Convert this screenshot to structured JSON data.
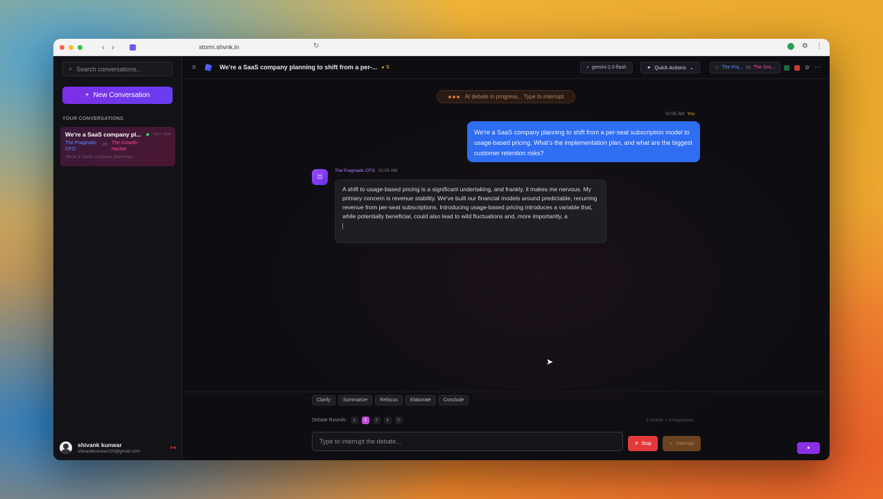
{
  "browser": {
    "url": "storm.shvnk.in"
  },
  "sidebar": {
    "search_placeholder": "Search conversations...",
    "new_conversation_label": "New Conversation",
    "section_label": "YOUR CONVERSATIONS",
    "conversation": {
      "title": "We're a SaaS company pl...",
      "time": "Just now",
      "agent_a": "The Pragmatic CFO",
      "vs": "vs",
      "agent_b": "The Growth-Hacker",
      "preview": "We're a SaaS company planning t..."
    },
    "user": {
      "name": "shivank kunwar",
      "email": "shivankkunwar100@gmail.com"
    }
  },
  "topbar": {
    "title": "We're a SaaS company planning to shift from a per-...",
    "model": "gemini-2.0-flash",
    "quick_actions": "Quick Actions",
    "agent_a": "The Pra...",
    "vs": "vs",
    "agent_b": "The Gro..."
  },
  "chat": {
    "status": "AI debate in progress... Type to interrupt",
    "user_time": "02:05 AM",
    "user_label": "You",
    "user_message": "We're a SaaS company planning to shift from a per-seat subscription model to usage-based pricing. What's the implementation plan, and what are the biggest customer retention risks?",
    "bot_name": "The Pragmatic CFO",
    "bot_time": "02:05 AM",
    "bot_message": "A shift to usage-based pricing is a significant undertaking, and frankly, it makes me nervous. My primary concern is revenue stability. We've built our financial models around predictable, recurring revenue from per-seat subscriptions. Introducing usage-based pricing introduces a variable that, while potentially beneficial, could also lead to wild fluctuations and, more importantly, a"
  },
  "quick_replies": [
    "Clarify",
    "Summarize",
    "Refocus",
    "Elaborate",
    "Conclude"
  ],
  "rounds": {
    "label": "Debate Rounds:",
    "options": [
      "1",
      "2",
      "3",
      "4",
      "5"
    ],
    "active": "2",
    "info": "2 rounds × 4 responses"
  },
  "composer": {
    "placeholder": "Type to interrupt the debate...",
    "stop_label": "Stop",
    "interrupt_label": "Interrupt"
  },
  "colors": {
    "accent": "#7b2fe6",
    "user_bubble": "#2f6df2",
    "stop": "#e23a3a"
  }
}
